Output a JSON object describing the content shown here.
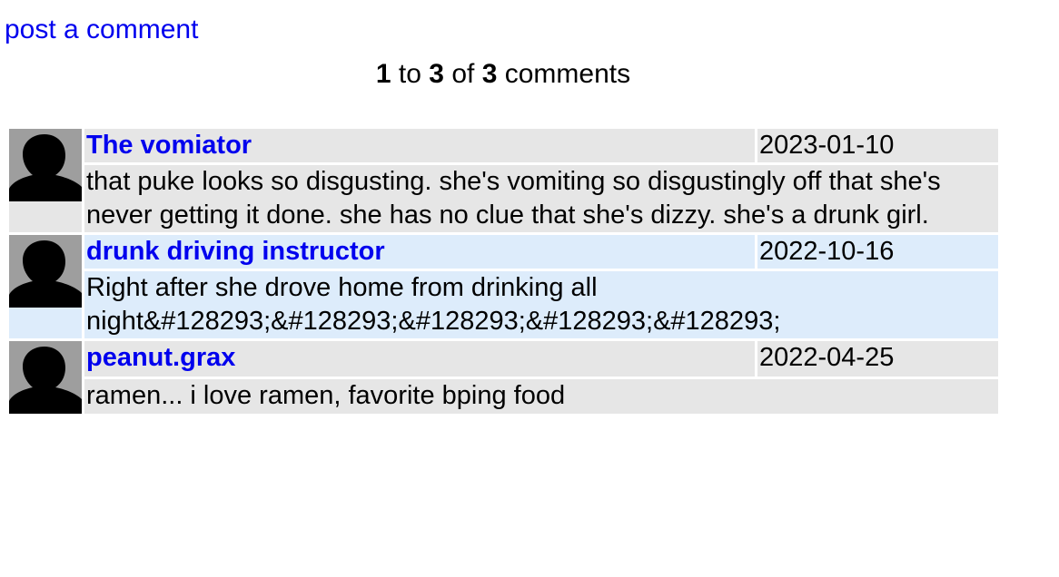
{
  "header": {
    "post_comment_label": "post a comment"
  },
  "pagination": {
    "start": "1",
    "to_word": "to",
    "end": "3",
    "of_word": "of",
    "total": "3",
    "suffix": "comments"
  },
  "comments": [
    {
      "author": "The vomiator",
      "date": "2023-01-10",
      "body": "that puke looks so disgusting. she's vomiting so disgustingly off that she's never getting it done. she has no clue that she's dizzy. she's a drunk girl.",
      "avatar_icon": "default-silhouette-icon"
    },
    {
      "author": "drunk driving instructor",
      "date": "2022-10-16",
      "body": "Right after she drove home from drinking all night&#128293;&#128293;&#128293;&#128293;&#128293;",
      "avatar_icon": "default-silhouette-icon"
    },
    {
      "author": "peanut.grax",
      "date": "2022-04-25",
      "body": "ramen... i love ramen, favorite bping food",
      "avatar_icon": "default-silhouette-icon"
    }
  ],
  "colors": {
    "link": "#0000ee",
    "row_gray": "#e6e6e6",
    "row_blue": "#ddecfb",
    "avatar_bg": "#9e9e9e"
  }
}
